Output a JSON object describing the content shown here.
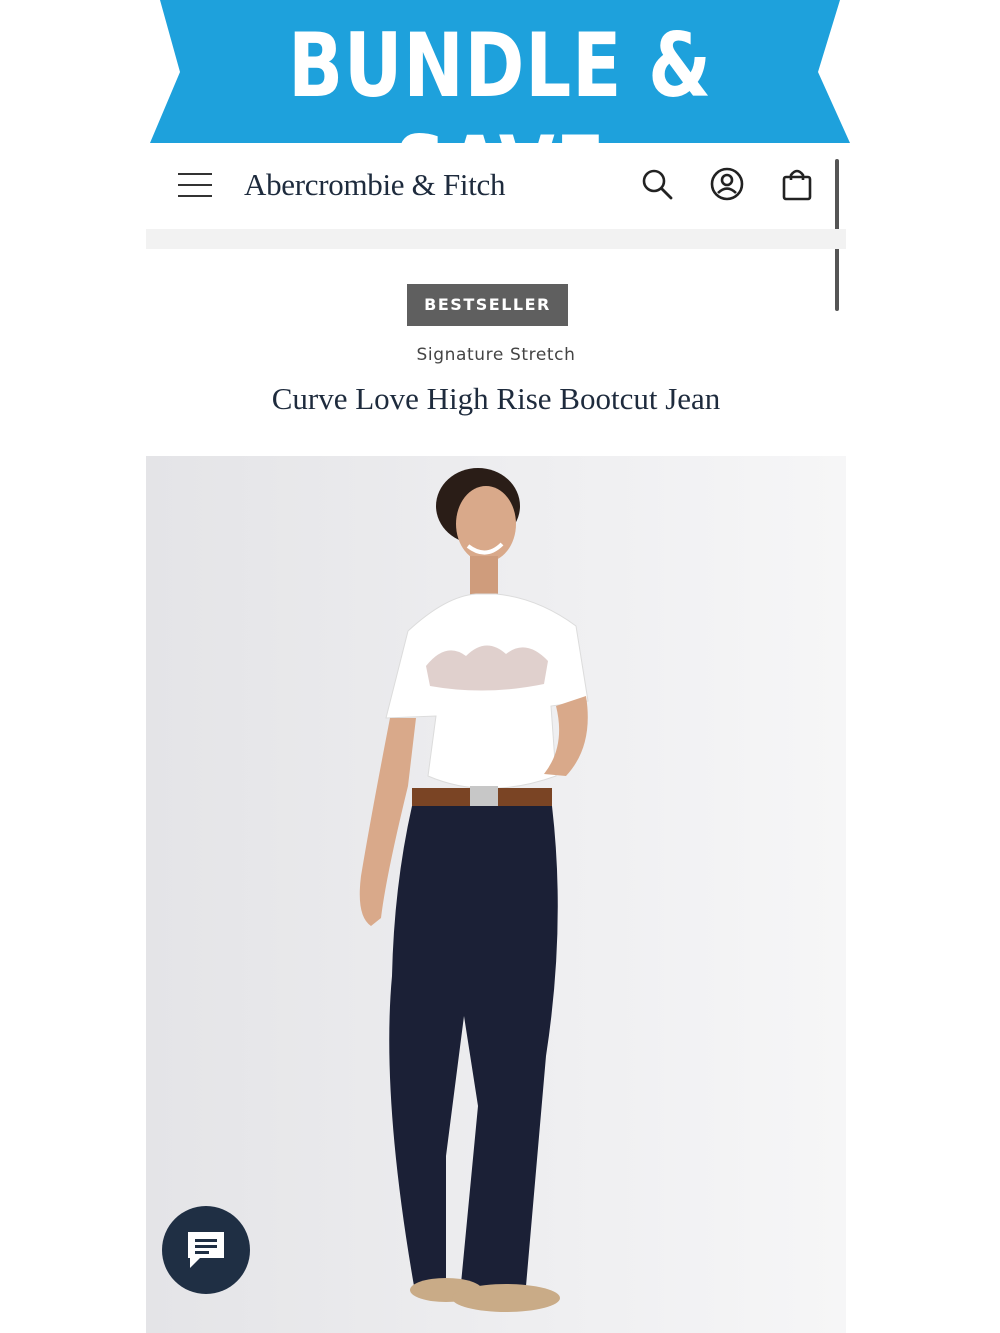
{
  "banner": {
    "text": "BUNDLE & SAVE",
    "color": "#1ea1dc"
  },
  "header": {
    "logo": "Abercrombie & Fitch",
    "icons": [
      "menu-icon",
      "search-icon",
      "account-icon",
      "shopping-bag-icon"
    ]
  },
  "product": {
    "badge": "BESTSELLER",
    "collection": "Signature Stretch",
    "name": "Curve Love High Rise Bootcut Jean"
  },
  "chat": {
    "icon": "chat-icon"
  },
  "colors": {
    "navy": "#1e2b3d",
    "badge_bg": "#5f5f5f",
    "photo_bg": "#ececee",
    "denim": "#1b2036"
  }
}
